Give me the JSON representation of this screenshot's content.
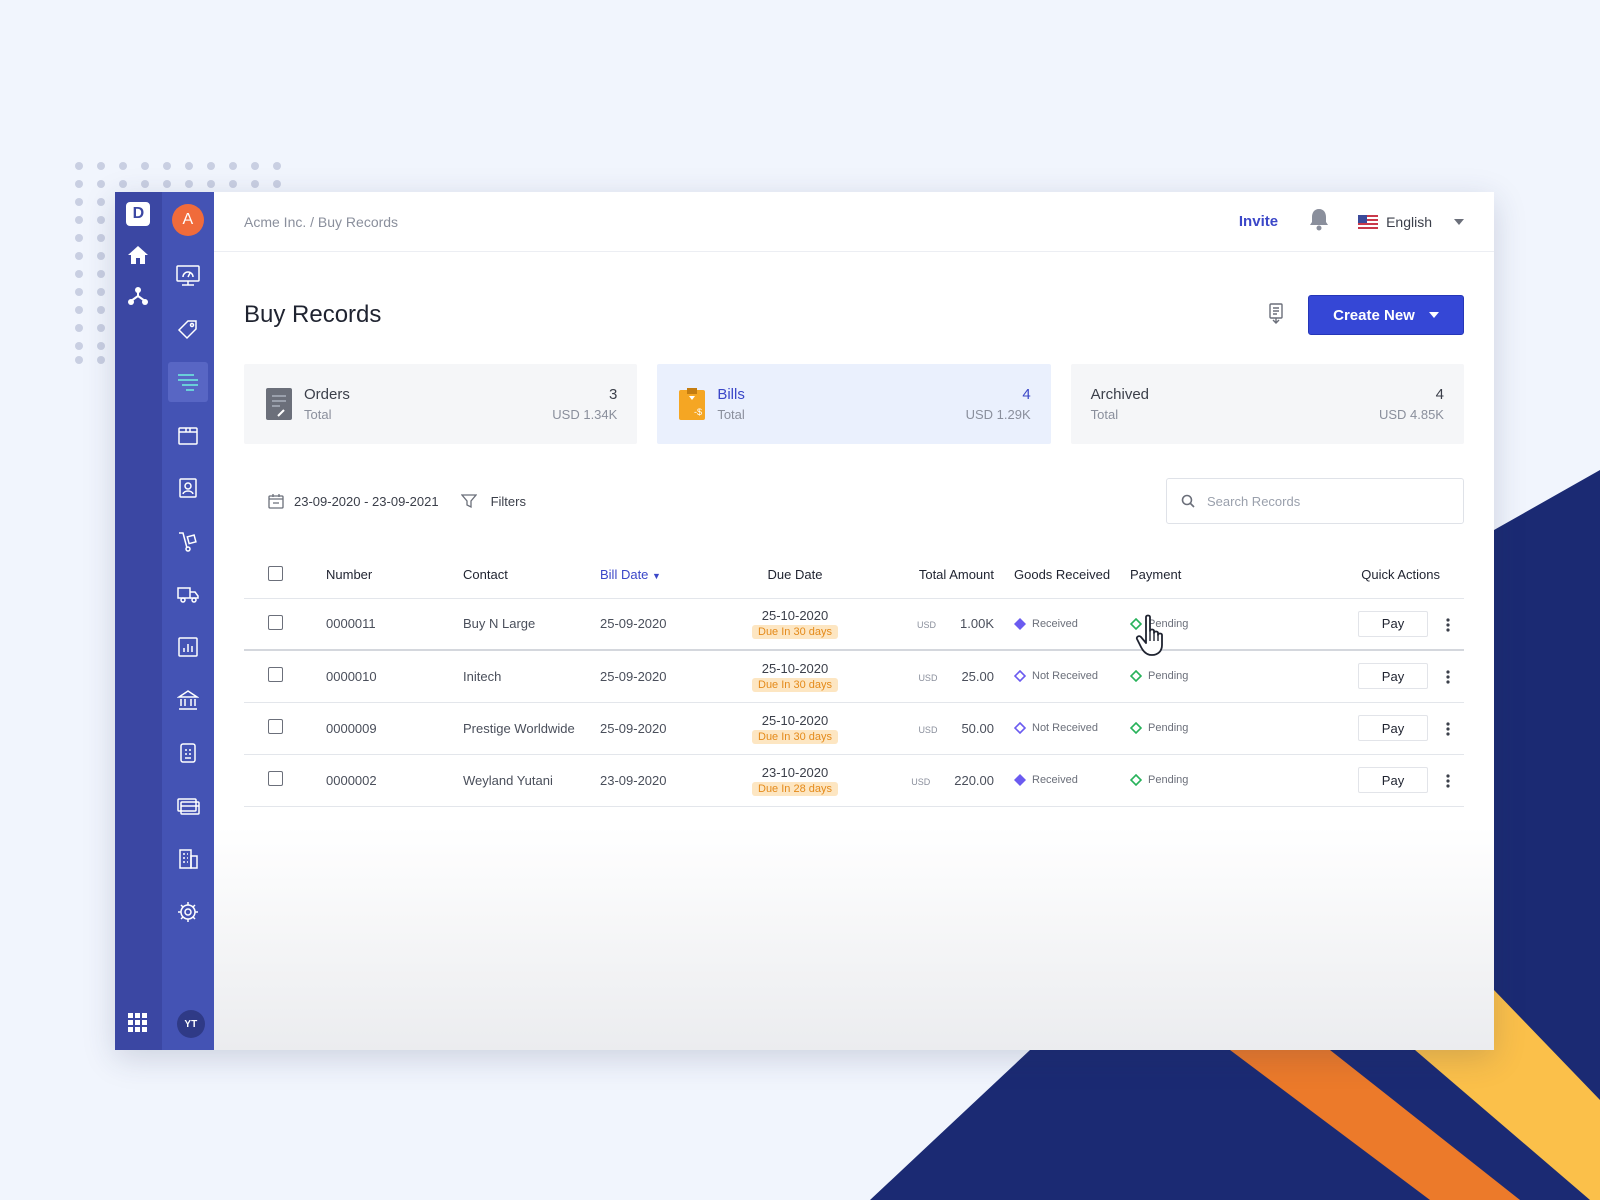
{
  "app": {
    "logo_letter": "D",
    "org_letter": "A",
    "user_initials": "YT"
  },
  "breadcrumb": "Acme Inc. / Buy Records",
  "topbar": {
    "invite_label": "Invite",
    "language": "English"
  },
  "page": {
    "title": "Buy Records",
    "create_label": "Create New"
  },
  "tiles": [
    {
      "name": "Orders",
      "sub": "Total",
      "count": "3",
      "amount": "USD 1.34K"
    },
    {
      "name": "Bills",
      "sub": "Total",
      "count": "4",
      "amount": "USD 1.29K"
    },
    {
      "name": "Archived",
      "sub": "Total",
      "count": "4",
      "amount": "USD 4.85K"
    }
  ],
  "filters": {
    "date_range": "23-09-2020 - 23-09-2021",
    "filters_label": "Filters",
    "search_placeholder": "Search Records"
  },
  "table": {
    "headers": {
      "number": "Number",
      "contact": "Contact",
      "bill_date": "Bill Date",
      "due_date": "Due Date",
      "total_amount": "Total Amount",
      "goods_received": "Goods Received",
      "payment": "Payment",
      "quick_actions": "Quick Actions"
    },
    "rows": [
      {
        "number": "0000011",
        "contact": "Buy N Large",
        "bill_date": "25-09-2020",
        "due_date": "25-10-2020",
        "due_badge": "Due In 30 days",
        "currency": "USD",
        "amount": "1.00K",
        "goods": "Received",
        "payment": "Pending",
        "action": "Pay"
      },
      {
        "number": "0000010",
        "contact": "Initech",
        "bill_date": "25-09-2020",
        "due_date": "25-10-2020",
        "due_badge": "Due In 30 days",
        "currency": "USD",
        "amount": "25.00",
        "goods": "Not Received",
        "payment": "Pending",
        "action": "Pay"
      },
      {
        "number": "0000009",
        "contact": "Prestige Worldwide",
        "bill_date": "25-09-2020",
        "due_date": "25-10-2020",
        "due_badge": "Due In 30 days",
        "currency": "USD",
        "amount": "50.00",
        "goods": "Not Received",
        "payment": "Pending",
        "action": "Pay"
      },
      {
        "number": "0000002",
        "contact": "Weyland Yutani",
        "bill_date": "23-09-2020",
        "due_date": "23-10-2020",
        "due_badge": "Due In 28 days",
        "currency": "USD",
        "amount": "220.00",
        "goods": "Received",
        "payment": "Pending",
        "action": "Pay"
      }
    ]
  },
  "colors": {
    "rail": "#3b47a3",
    "sidebar": "#4453b4",
    "accent": "#3547d6",
    "org_avatar": "#f06b3b",
    "due_badge_bg": "#fde6c2",
    "received": "#6b5bf0",
    "pending": "#27b25a"
  }
}
